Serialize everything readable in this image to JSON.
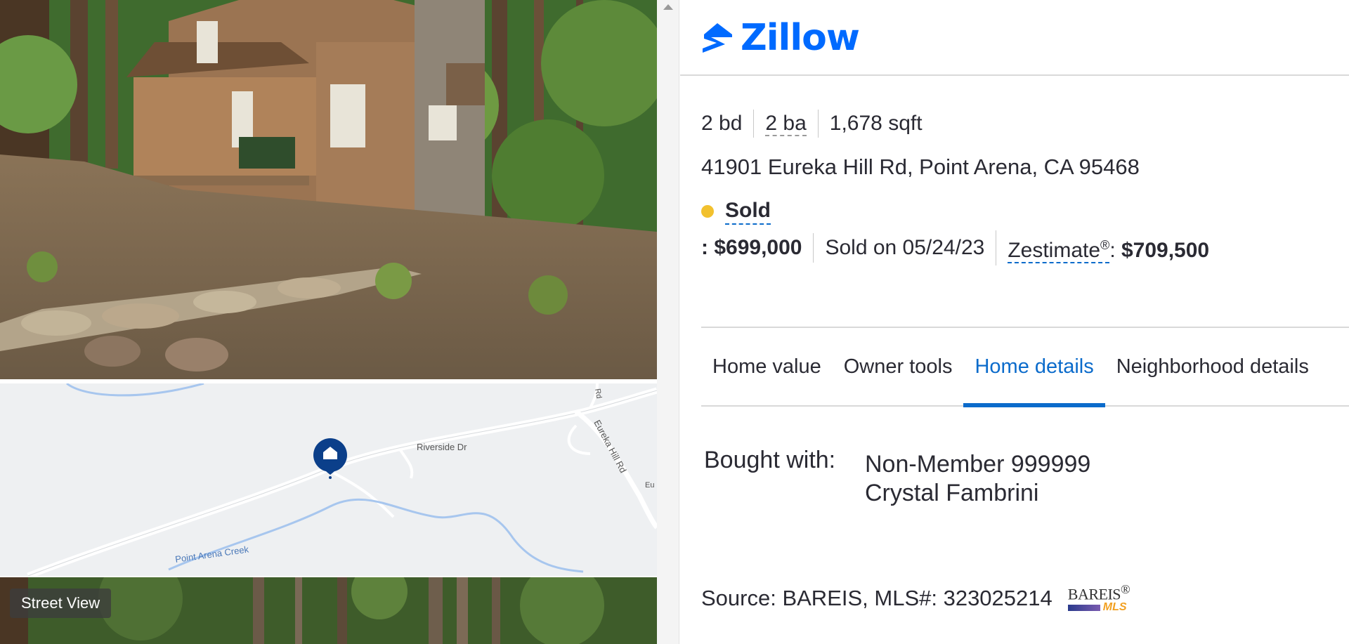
{
  "brand": {
    "name": "Zillow",
    "color": "#006aff"
  },
  "left": {
    "street_view_label": "Street View",
    "map_labels": {
      "riverside": "Riverside Dr",
      "eureka": "Eureka Hill Rd",
      "creek": "Point Arena Creek",
      "rd_top": "Rd",
      "eu": "Eu"
    }
  },
  "facts": {
    "beds": "2 bd",
    "baths": "2 ba",
    "sqft": "1,678 sqft"
  },
  "address": "41901 Eureka Hill Rd, Point Arena, CA 95468",
  "status": {
    "label": "Sold",
    "dot_color": "#f2c12e"
  },
  "price_row": {
    "price": ": $699,000",
    "sold_on": "Sold on 05/24/23",
    "zestimate_label": "Zestimate",
    "zestimate_sup": "®",
    "zestimate_sep": ": ",
    "zestimate_value": "$709,500"
  },
  "tabs": [
    {
      "label": "Home value",
      "active": false
    },
    {
      "label": "Owner tools",
      "active": false
    },
    {
      "label": "Home details",
      "active": true
    },
    {
      "label": "Neighborhood details",
      "active": false
    }
  ],
  "bought_with": {
    "label": "Bought with:",
    "lines": [
      "Non-Member 999999",
      "Crystal Fambrini"
    ]
  },
  "source": {
    "text": "Source: BAREIS,  MLS#: 323025214",
    "logo_top": "BAREIS",
    "logo_reg": "®",
    "logo_bottom": "MLS"
  },
  "accent_color": "#0b6bcb"
}
